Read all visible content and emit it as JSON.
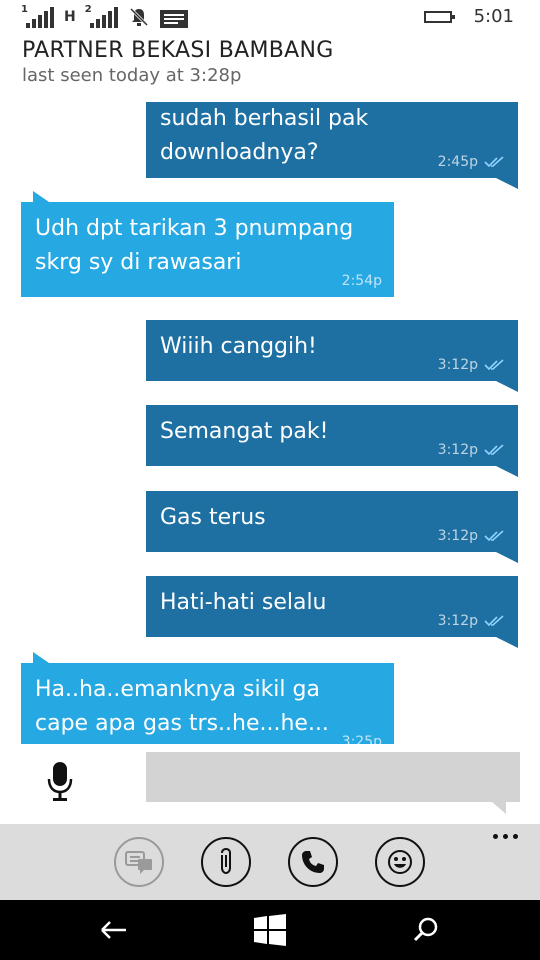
{
  "statusbar": {
    "sim1_label": "1",
    "network_type": "H",
    "sim2_label": "2",
    "time": "5:01"
  },
  "header": {
    "contact_name": "PARTNER BEKASI BAMBANG",
    "last_seen": "last seen today at 3:28p"
  },
  "messages": [
    {
      "direction": "out",
      "text": "sudah berhasil pak downloadnya?",
      "time": "2:45p",
      "status": "read"
    },
    {
      "direction": "in",
      "text": "Udh dpt tarikan 3 pnumpang skrg sy di rawasari",
      "time": "2:54p"
    },
    {
      "direction": "out",
      "text": "Wiiih canggih!",
      "time": "3:12p",
      "status": "read"
    },
    {
      "direction": "out",
      "text": "Semangat pak!",
      "time": "3:12p",
      "status": "read"
    },
    {
      "direction": "out",
      "text": "Gas terus",
      "time": "3:12p",
      "status": "read"
    },
    {
      "direction": "out",
      "text": "Hati-hati selalu",
      "time": "3:12p",
      "status": "read"
    },
    {
      "direction": "in",
      "text": "Ha..ha..emanknya sikil ga cape apa gas trs..he...he...",
      "time": "3:25p"
    }
  ],
  "compose": {
    "value": "",
    "placeholder": ""
  },
  "appbar": {
    "buttons": [
      "quick-reply-icon",
      "attach-icon",
      "call-icon",
      "emoji-icon"
    ]
  },
  "colors": {
    "outgoing_bubble": "#1e6fa2",
    "incoming_bubble": "#26a8e3",
    "compose_bg": "#d3d3d3",
    "appbar_bg": "#dcdcdc",
    "navbar_bg": "#000000"
  }
}
